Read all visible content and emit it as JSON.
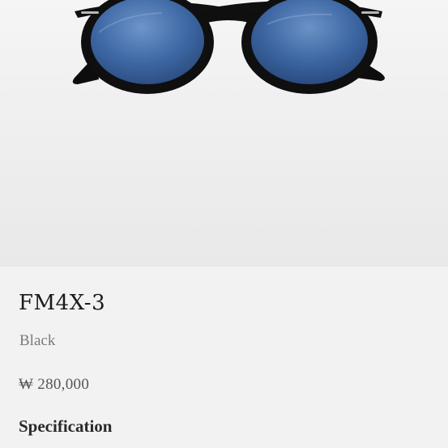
{
  "product": {
    "model": "FM4X-3",
    "color": "Black",
    "price": "₩ 280,000",
    "spec_heading": "Specification",
    "image_icon": "sunglasses-image",
    "lens_color": "#3d6aa8",
    "frame_color": "#111111",
    "background_color": "#f2f2f2"
  }
}
